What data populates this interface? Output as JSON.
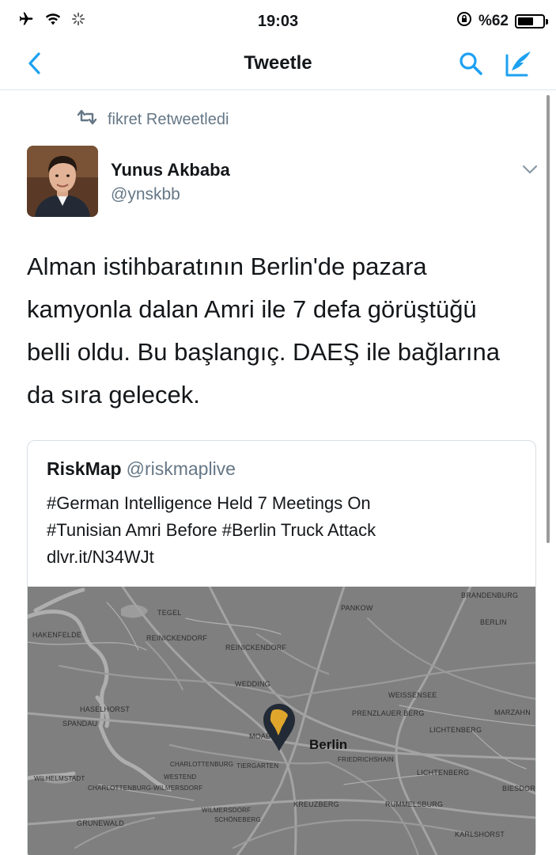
{
  "status_bar": {
    "time": "19:03",
    "battery_text": "%62",
    "battery_level": 0.62,
    "icons": [
      "airplane-icon",
      "wifi-icon",
      "activity-spinner-icon",
      "rotation-lock-icon",
      "battery-icon"
    ]
  },
  "nav": {
    "title": "Tweetle",
    "icons": [
      "back-chevron-icon",
      "search-icon",
      "compose-icon"
    ],
    "accent_color": "#1da1f2"
  },
  "retweet": {
    "text": "fikret Retweetledi"
  },
  "tweet": {
    "author_name": "Yunus Akbaba",
    "author_handle": "@ynskbb",
    "text": "Alman istihbaratının Berlin'de pazara\nkamyonla dalan Amri ile 7 defa görüştüğü\nbelli oldu. Bu başlangıç. DAEŞ ile bağlarına\nda sıra gelecek."
  },
  "quote": {
    "name": "RiskMap",
    "handle": "@riskmaplive",
    "text": "#German Intelligence Held 7 Meetings On\n#Tunisian Amri Before #Berlin Truck Attack\ndlvr.it/N34WJt"
  },
  "map": {
    "city_label": "Berlin",
    "labels": [
      {
        "text": "PANKOW"
      },
      {
        "text": "BRANDENBURG"
      },
      {
        "text": "BERLIN"
      },
      {
        "text": "TEGEL"
      },
      {
        "text": "HAKENFELDE"
      },
      {
        "text": "REINICKENDORF"
      },
      {
        "text": "REINICKENDORF"
      },
      {
        "text": "WEDDING"
      },
      {
        "text": "WEISSENSEE"
      },
      {
        "text": "PRENZLAUER BERG"
      },
      {
        "text": "HASELHORST"
      },
      {
        "text": "SPANDAU"
      },
      {
        "text": "MOAB"
      },
      {
        "text": "MARZAHN"
      },
      {
        "text": "LICHTENBERG"
      },
      {
        "text": "CHARLOTTENBURG"
      },
      {
        "text": "TIERGARTEN"
      },
      {
        "text": "FRIEDRICHSHAIN"
      },
      {
        "text": "LICHTENBERG"
      },
      {
        "text": "WESTEND"
      },
      {
        "text": "WILHELMSTADT"
      },
      {
        "text": "CHARLOTTENBURG-WILMERSDORF"
      },
      {
        "text": "BIESDORF"
      },
      {
        "text": "KREUZBERG"
      },
      {
        "text": "RUMMELSBURG"
      },
      {
        "text": "WILMERSDORF"
      },
      {
        "text": "SCHÖNEBERG"
      },
      {
        "text": "GRUNEWALD"
      },
      {
        "text": "KARLSHORST"
      }
    ],
    "pin_icon": "africa-map-pin-icon",
    "pin_color": "#222a35",
    "pin_fill": "#e0a62c"
  }
}
